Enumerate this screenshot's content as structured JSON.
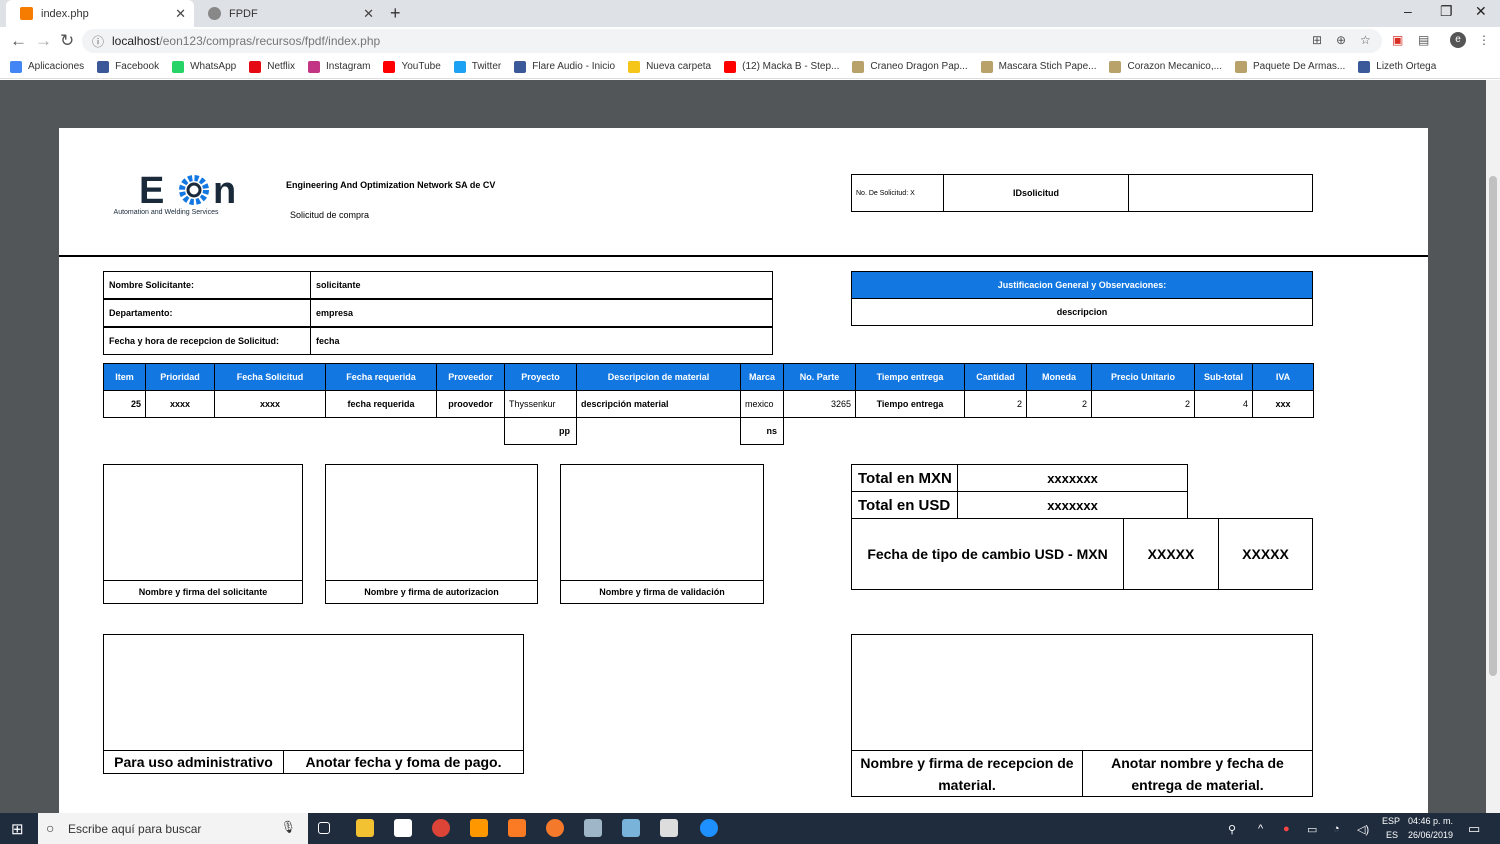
{
  "browser": {
    "tabs": [
      {
        "title": "index.php",
        "active": true
      },
      {
        "title": "FPDF",
        "active": false
      }
    ],
    "url_host": "localhost",
    "url_path": "/eon123/compras/recursos/fpdf/index.php",
    "bookmarks": [
      "Aplicaciones",
      "Facebook",
      "WhatsApp",
      "Netflix",
      "Instagram",
      "YouTube",
      "Twitter",
      "Flare Audio - Inicio",
      "Nueva carpeta",
      "(12) Macka B - Step...",
      "Craneo Dragon Pap...",
      "Mascara Stich Pape...",
      "Corazon Mecanico,...",
      "Paquete De Armas...",
      "Lizeth Ortega"
    ],
    "bookmark_colors": [
      "#4285f4",
      "#3b5998",
      "#25d366",
      "#e50914",
      "#c13584",
      "#ff0000",
      "#1da1f2",
      "#3b5998",
      "#f5c518",
      "#ff0000",
      "#b9a16a",
      "#b9a16a",
      "#b9a16a",
      "#b9a16a",
      "#3b5998"
    ]
  },
  "doc": {
    "logo_text": "EON",
    "logo_sub": "Automation and Welding Services",
    "company": "Engineering And Optimization Network SA de CV",
    "doc_type": "Solicitud de compra",
    "no_solicitud_label": "No. De Solicitud: X",
    "id_solicitud": "IDsolicitud",
    "info": {
      "labels": [
        "Nombre Solicitante:",
        "Departamento:",
        "Fecha y hora de recepcion de Solicitud:"
      ],
      "values": [
        "solicitante",
        "empresa",
        "fecha"
      ]
    },
    "justificacion_header": "Justificacion General y Observaciones:",
    "justificacion_value": "descripcion",
    "table": {
      "headers": [
        "Item",
        "Prioridad",
        "Fecha Solicitud",
        "Fecha requerida",
        "Proveedor",
        "Proyecto",
        "Descripcion de material",
        "Marca",
        "No. Parte",
        "Tiempo entrega",
        "Cantidad",
        "Moneda",
        "Precio Unitario",
        "Sub-total",
        "IVA"
      ],
      "row": [
        "25",
        "xxxx",
        "xxxx",
        "fecha requerida",
        "proovedor",
        "Thyssenkur",
        "descripción material",
        "mexico",
        "3265",
        "Tiempo entrega",
        "2",
        "2",
        "2",
        "4",
        "xxx"
      ],
      "row_wrap": {
        "proyecto": "pp",
        "marca": "ns"
      }
    },
    "signatures": [
      "Nombre y firma del solicitante",
      "Nombre y firma de autorizacion",
      "Nombre y firma de validación"
    ],
    "totals": {
      "mxn_label": "Total en MXN",
      "mxn_value": "xxxxxxx",
      "usd_label": "Total en USD",
      "usd_value": "xxxxxxx",
      "fx_label": "Fecha de tipo de cambio USD - MXN",
      "fx_value1": "XXXXX",
      "fx_value2": "XXXXX"
    },
    "admin": {
      "label": "Para uso administrativo",
      "note": "Anotar fecha y foma de pago."
    },
    "reception": {
      "label": "Nombre y firma de recepcion de material.",
      "note": "Anotar nombre y fecha de entrega de material."
    }
  },
  "taskbar": {
    "search_placeholder": "Escribe aquí para buscar",
    "lang1": "ESP",
    "lang2": "ES",
    "time": "04:46 p. m.",
    "date": "26/06/2019"
  }
}
